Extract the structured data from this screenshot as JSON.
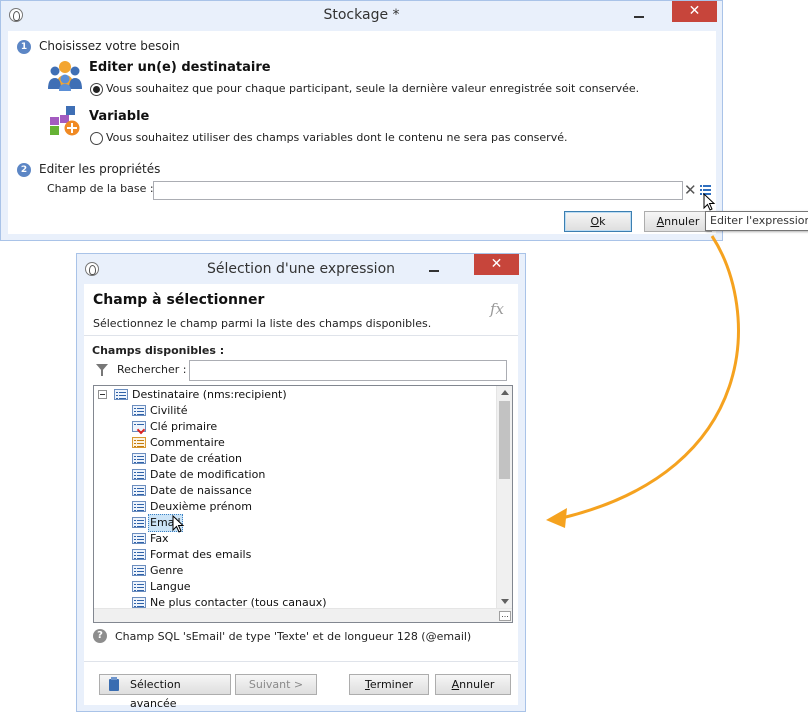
{
  "stockage": {
    "title": "Stockage *",
    "step1": {
      "num": "1",
      "label": "Choisissez votre besoin"
    },
    "option_recipient": {
      "title": "Editer un(e) destinataire",
      "desc": "Vous souhaitez que pour chaque participant, seule la dernière valeur enregistrée soit conservée.",
      "selected": true
    },
    "option_variable": {
      "title": "Variable",
      "desc": "Vous souhaitez utiliser des champs variables dont le contenu ne sera pas conservé.",
      "selected": false
    },
    "step2": {
      "num": "2",
      "label": "Editer les propriétés"
    },
    "db_field_label": "Champ de la base :",
    "db_field_value": "",
    "ok_label": "Ok",
    "cancel_label": "Annuler",
    "tooltip": "Editer l'expression",
    "close_glyph": "✕",
    "clear_glyph": "✕"
  },
  "selection": {
    "title": "Sélection d'une expression",
    "header_title": "Champ à sélectionner",
    "header_sub": "Sélectionnez le champ parmi la liste des champs disponibles.",
    "fx": "fx",
    "available_label": "Champs disponibles :",
    "search_label": "Rechercher :",
    "search_value": "",
    "tree_root": "Destinataire (nms:recipient)",
    "tree_items": [
      {
        "label": "Civilité",
        "icon": "field-icon"
      },
      {
        "label": "Clé primaire",
        "icon": "primary-key-icon"
      },
      {
        "label": "Commentaire",
        "icon": "memo-field-icon"
      },
      {
        "label": "Date de création",
        "icon": "field-icon"
      },
      {
        "label": "Date de modification",
        "icon": "field-icon"
      },
      {
        "label": "Date de naissance",
        "icon": "field-icon"
      },
      {
        "label": "Deuxième prénom",
        "icon": "field-icon"
      },
      {
        "label": "Email",
        "icon": "field-icon",
        "selected": true
      },
      {
        "label": "Fax",
        "icon": "field-icon"
      },
      {
        "label": "Format des emails",
        "icon": "field-icon"
      },
      {
        "label": "Genre",
        "icon": "field-icon"
      },
      {
        "label": "Langue",
        "icon": "field-icon"
      },
      {
        "label": "Ne plus contacter (tous canaux)",
        "icon": "field-icon"
      }
    ],
    "info_text": "Champ SQL 'sEmail' de type 'Texte' et de longueur 128 (@email)",
    "help_glyph": "?",
    "more_glyph": "...",
    "btn_advanced": "Sélection avancée",
    "btn_next": "Suivant >",
    "btn_finish": "Terminer",
    "btn_cancel": "Annuler",
    "close_glyph": "✕"
  },
  "colors": {
    "arrow": "#f5a21f",
    "title_bar": "#e9f0fb",
    "close_red": "#c7453b",
    "step_badge": "#5c86c5"
  }
}
